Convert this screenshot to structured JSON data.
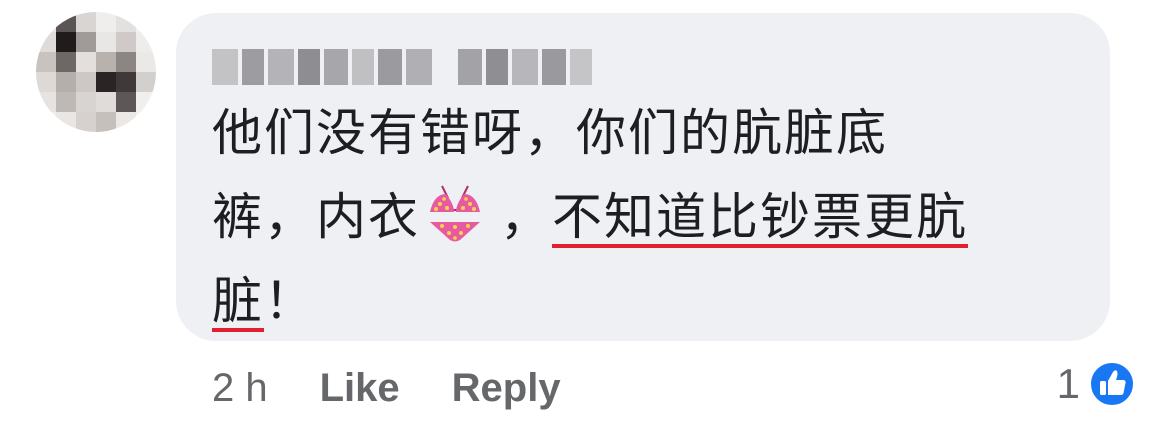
{
  "comment": {
    "author_name_redacted": "",
    "text_line1": "他们没有错呀，你们的肮脏底",
    "text_line2_pre": "裤，内衣",
    "text_line2_post": "，",
    "text_underlined_1": "不知道比钞票更肮",
    "text_underlined_2": "脏",
    "text_line3_post": "！",
    "emoji": "bikini-emoji"
  },
  "actions": {
    "time": "2 h",
    "like_label": "Like",
    "reply_label": "Reply"
  },
  "reactions": {
    "count": "1",
    "icon": "like-thumb-icon",
    "icon_color": "#1877f2"
  },
  "colors": {
    "bubble": "#eff0f4",
    "text": "#1c1e21",
    "meta": "#65676b",
    "underline": "#e02030"
  }
}
